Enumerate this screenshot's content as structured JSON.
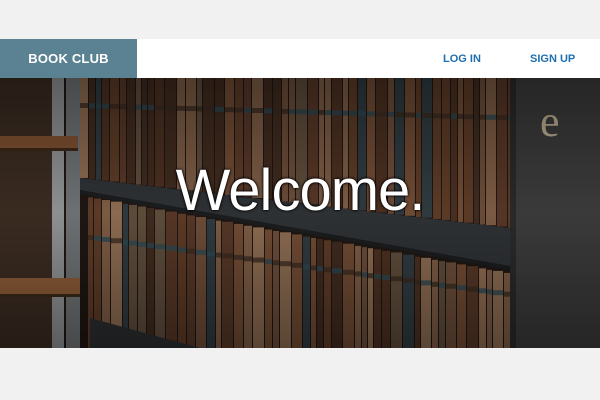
{
  "navbar": {
    "brand": "BOOK CLUB",
    "login_label": "LOG IN",
    "signup_label": "SIGN UP"
  },
  "hero": {
    "heading": "Welcome.",
    "spine_letter": "e"
  },
  "colors": {
    "brand_bg": "#5a8293",
    "link": "#1f6fb0",
    "page_bg": "#f1f1f1"
  }
}
